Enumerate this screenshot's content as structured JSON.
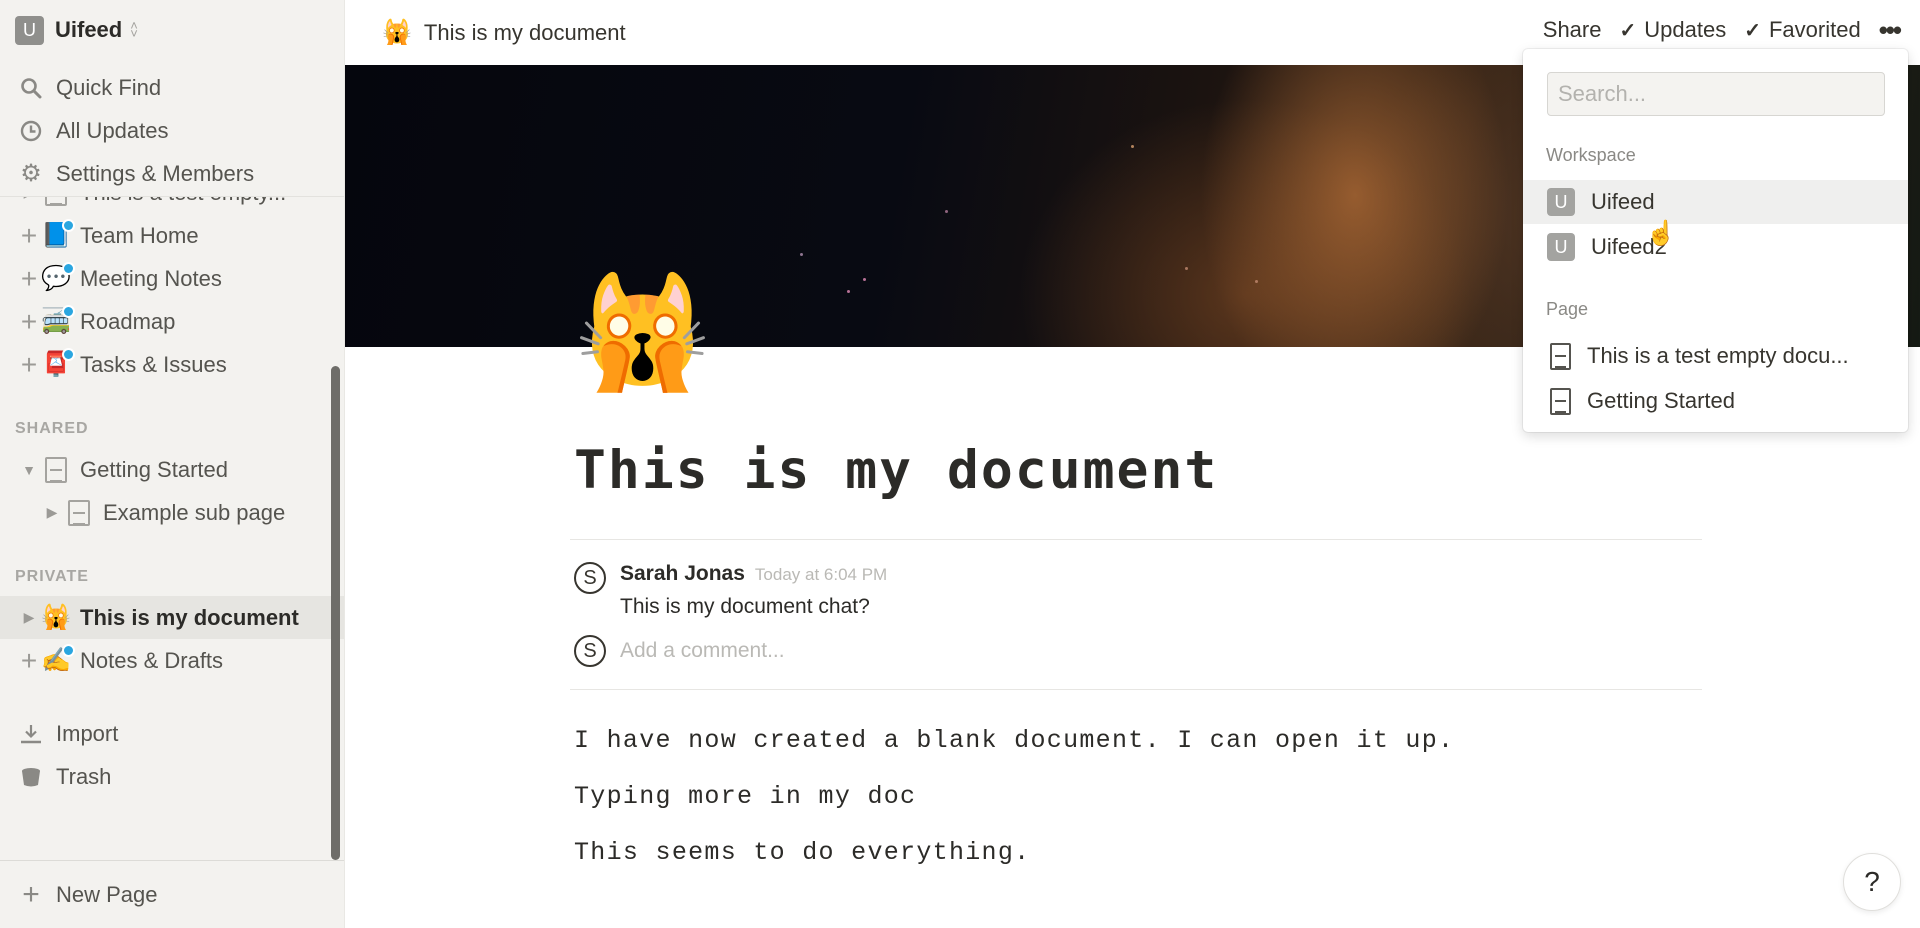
{
  "workspace": {
    "initial": "U",
    "name": "Uifeed"
  },
  "sidebar": {
    "top_nav": [
      {
        "icon": "search-icon",
        "label": "Quick Find"
      },
      {
        "icon": "clock-icon",
        "label": "All Updates"
      },
      {
        "icon": "gear-icon",
        "label": "Settings & Members"
      }
    ],
    "workspace_pages": [
      {
        "emoji": "📄",
        "label": "This is a test empty...",
        "partial": true
      },
      {
        "emoji": "📘",
        "label": "Team Home",
        "badge": true
      },
      {
        "emoji": "💬",
        "label": "Meeting Notes",
        "badge": true
      },
      {
        "emoji": "🚎",
        "label": "Roadmap",
        "badge": true
      },
      {
        "emoji": "📮",
        "label": "Tasks & Issues",
        "badge": true
      }
    ],
    "shared_label": "SHARED",
    "shared_pages": [
      {
        "label": "Getting Started",
        "expanded": true
      },
      {
        "label": "Example sub page",
        "child": true
      }
    ],
    "private_label": "PRIVATE",
    "private_pages": [
      {
        "emoji": "🙀",
        "label": "This is my document",
        "active": true
      },
      {
        "emoji": "✍️",
        "label": "Notes & Drafts",
        "badge": true
      }
    ],
    "bottom_nav": [
      {
        "icon": "import-icon",
        "label": "Import"
      },
      {
        "icon": "trash-icon",
        "label": "Trash"
      }
    ],
    "new_page_label": "New Page"
  },
  "topbar": {
    "page_emoji": "🙀",
    "page_title": "This is my document",
    "share_label": "Share",
    "updates_label": "Updates",
    "favorited_label": "Favorited",
    "more_label": "•••"
  },
  "page": {
    "icon": "🙀",
    "title": "This is my document",
    "comments": [
      {
        "avatar": "S",
        "author": "Sarah Jonas",
        "time": "Today at 6:04 PM",
        "text": "This is my document chat?"
      }
    ],
    "add_comment": {
      "avatar": "S",
      "placeholder": "Add a comment..."
    },
    "body": [
      "I have now created a blank document. I can open it up.",
      "Typing more in my doc",
      "This seems to do everything."
    ]
  },
  "dropdown": {
    "search_placeholder": "Search...",
    "search_value": "",
    "workspace_section": "Workspace",
    "workspaces": [
      {
        "initial": "U",
        "name": "Uifeed",
        "hover": true
      },
      {
        "initial": "U",
        "name": "Uifeed2"
      }
    ],
    "page_section": "Page",
    "pages": [
      {
        "title": "This is a test empty docu..."
      },
      {
        "title": "Getting Started"
      }
    ]
  },
  "help": {
    "label": "?"
  },
  "colors": {
    "sidebar_bg": "#f3f2ef",
    "badge": "#2aa6e0",
    "text": "#37352f"
  }
}
